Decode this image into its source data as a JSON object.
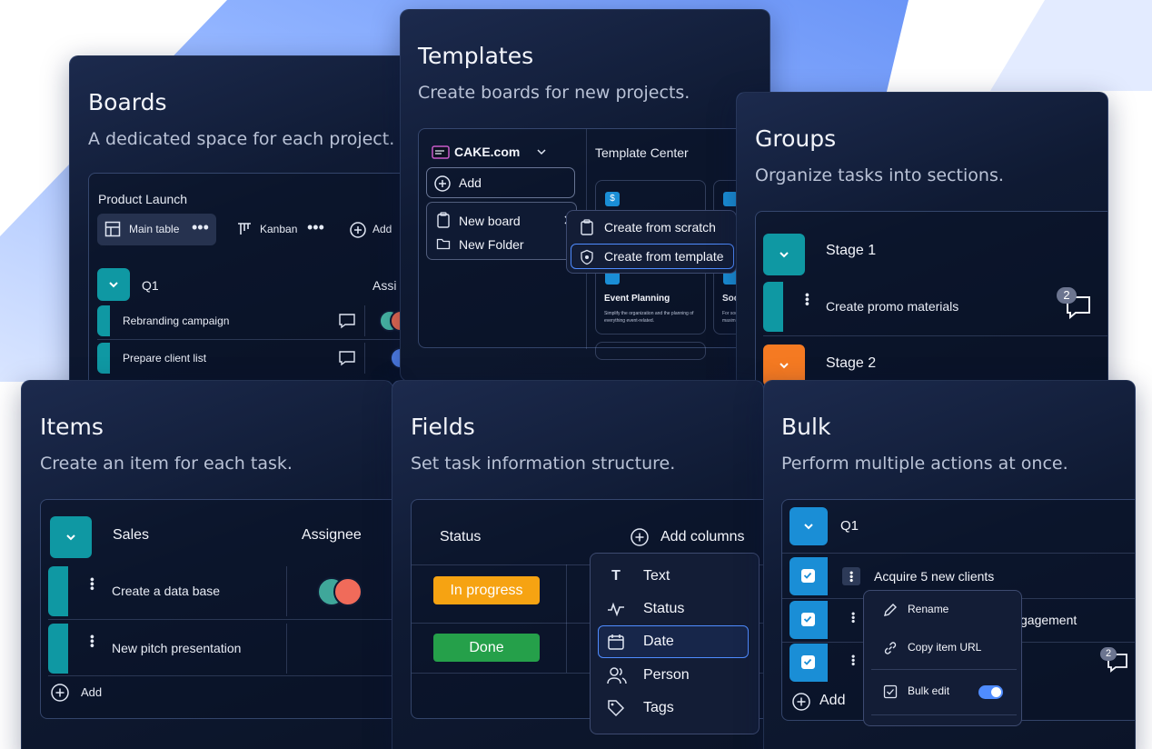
{
  "colors": {
    "teal": "#0f98a3",
    "orange": "#f57a22",
    "blue": "#1a8ed6",
    "progress": "#f6a312",
    "done": "#25a04a"
  },
  "boards": {
    "title": "Boards",
    "subtitle": "A dedicated space for each project.",
    "board_name": "Product Launch",
    "view_main": "Main table",
    "view_kanban": "Kanban",
    "add": "Add",
    "group": "Q1",
    "assignee_header": "Assi",
    "rows": [
      {
        "label": "Rebranding campaign"
      },
      {
        "label": "Prepare client list"
      }
    ]
  },
  "templates": {
    "title": "Templates",
    "subtitle": "Create boards for new projects.",
    "workspace": "CAKE.com",
    "add": "Add",
    "new_board": "New board",
    "new_folder": "New Folder",
    "center": "Template Center",
    "from_scratch": "Create from scratch",
    "from_template": "Create from template",
    "card1_title": "Event Planning",
    "card1_desc": "Simplify the organization and the planning of everything event-related.",
    "card2_title": "Soc",
    "card2_desc": "For soc maxim"
  },
  "groups": {
    "title": "Groups",
    "subtitle": "Organize tasks into sections.",
    "stage1": "Stage 1",
    "task": "Create promo materials",
    "comment_count": "2",
    "stage2": "Stage 2"
  },
  "items": {
    "title": "Items",
    "subtitle": "Create an item for each task.",
    "group": "Sales",
    "assignee": "Assignee",
    "rows": [
      {
        "label": "Create a data base"
      },
      {
        "label": "New pitch presentation"
      }
    ],
    "add": "Add"
  },
  "fields": {
    "title": "Fields",
    "subtitle": "Set task information structure.",
    "status_header": "Status",
    "add_columns": "Add columns",
    "status1": "In progress",
    "status2": "Done",
    "menu": [
      {
        "label": "Text",
        "icon": "text-icon"
      },
      {
        "label": "Status",
        "icon": "status-icon"
      },
      {
        "label": "Date",
        "icon": "calendar-icon"
      },
      {
        "label": "Person",
        "icon": "people-icon"
      },
      {
        "label": "Tags",
        "icon": "tag-icon"
      }
    ]
  },
  "bulk": {
    "title": "Bulk",
    "subtitle": "Perform multiple actions at once.",
    "group": "Q1",
    "row1": "Acquire 5 new clients",
    "row2_tail": "gagement",
    "comment_count": "2",
    "rename": "Rename",
    "copy_url": "Copy item URL",
    "bulk_edit": "Bulk edit",
    "add": "Add"
  }
}
